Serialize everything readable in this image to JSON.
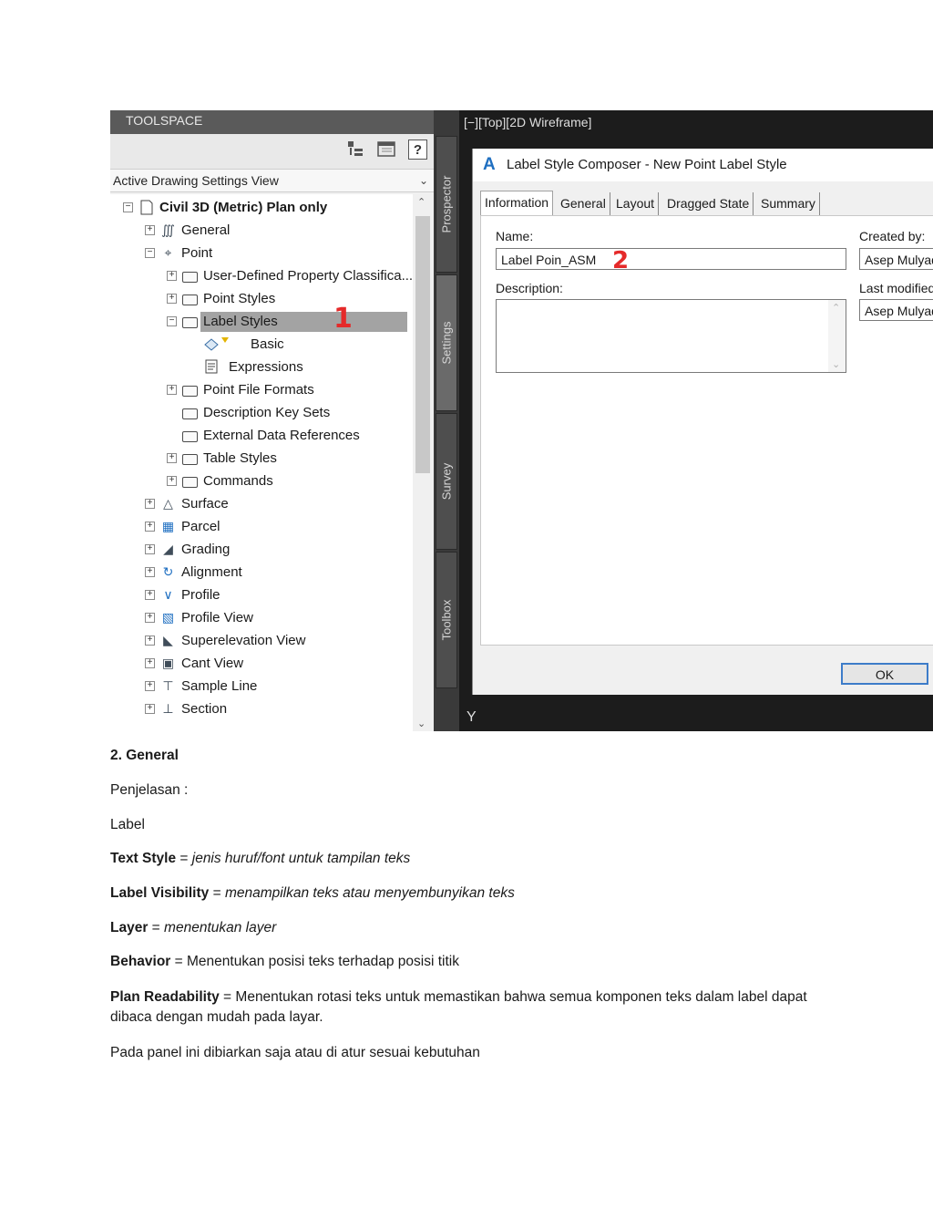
{
  "toolspace": {
    "title": "TOOLSPACE",
    "help_label": "?",
    "view_selector": "Active Drawing Settings View",
    "tree": [
      {
        "label": "Civil 3D (Metric) Plan only",
        "expander": "−",
        "icon": "drawing-icon"
      },
      {
        "label": "General",
        "expander": "+",
        "icon": "general-icon"
      },
      {
        "label": "Point",
        "expander": "−",
        "icon": "point-icon"
      },
      {
        "label": "User-Defined Property Classifica...",
        "expander": "+",
        "icon": "folder-icon"
      },
      {
        "label": "Point Styles",
        "expander": "+",
        "icon": "folder-icon"
      },
      {
        "label": "Label Styles",
        "expander": "−",
        "icon": "folder-icon",
        "selected": true
      },
      {
        "label": "Basic",
        "expander": "",
        "icon": "label-style-icon"
      },
      {
        "label": "Expressions",
        "expander": "",
        "icon": "expressions-icon"
      },
      {
        "label": "Point File Formats",
        "expander": "+",
        "icon": "folder-icon"
      },
      {
        "label": "Description Key Sets",
        "expander": "",
        "icon": "folder-icon"
      },
      {
        "label": "External Data References",
        "expander": "",
        "icon": "folder-icon"
      },
      {
        "label": "Table Styles",
        "expander": "+",
        "icon": "folder-icon"
      },
      {
        "label": "Commands",
        "expander": "+",
        "icon": "folder-icon"
      },
      {
        "label": "Surface",
        "expander": "+",
        "icon": "surface-icon"
      },
      {
        "label": "Parcel",
        "expander": "+",
        "icon": "parcel-icon"
      },
      {
        "label": "Grading",
        "expander": "+",
        "icon": "grading-icon"
      },
      {
        "label": "Alignment",
        "expander": "+",
        "icon": "alignment-icon"
      },
      {
        "label": "Profile",
        "expander": "+",
        "icon": "profile-icon"
      },
      {
        "label": "Profile View",
        "expander": "+",
        "icon": "profile-view-icon"
      },
      {
        "label": "Superelevation View",
        "expander": "+",
        "icon": "superelevation-icon"
      },
      {
        "label": "Cant View",
        "expander": "+",
        "icon": "cant-view-icon"
      },
      {
        "label": "Sample Line",
        "expander": "+",
        "icon": "sample-line-icon"
      },
      {
        "label": "Section",
        "expander": "+",
        "icon": "section-icon"
      }
    ],
    "side_tabs": [
      "Prospector",
      "Settings",
      "Survey",
      "Toolbox"
    ],
    "active_side_tab": "Settings"
  },
  "annotations": {
    "marker1": "1",
    "marker2": "2",
    "color": "#e52a2a"
  },
  "viewport": {
    "label": "[−][Top][2D Wireframe]",
    "ucs_label": "Y"
  },
  "dialog": {
    "title": "Label Style Composer - New Point Label Style",
    "tabs": [
      "Information",
      "General",
      "Layout",
      "Dragged State",
      "Summary"
    ],
    "active_tab": "Information",
    "name_label": "Name:",
    "name_value": "Label Poin_ASM",
    "description_label": "Description:",
    "description_value": "",
    "created_by_label": "Created by:",
    "created_by_value": "Asep Mulyadi",
    "last_modified_label": "Last modified",
    "last_modified_value": "Asep Mulyadi",
    "ok_label": "OK"
  },
  "document": {
    "heading": "2. General",
    "intro": "Penjelasan :",
    "label_word": "Label",
    "items": [
      {
        "term": "Text Style",
        "sep": " = ",
        "desc": "jenis huruf/font untuk tampilan teks",
        "italic": true
      },
      {
        "term": "Label Visibility",
        "sep": " = ",
        "desc": "menampilkan teks atau menyembunyikan teks",
        "italic": true
      },
      {
        "term": "Layer",
        "sep": " = ",
        "desc": "menentukan layer",
        "italic": true
      },
      {
        "term": "Behavior",
        "sep": " = ",
        "desc": "Menentukan posisi teks terhadap posisi titik",
        "italic": false
      },
      {
        "term": "Plan Readability",
        "sep": " = ",
        "desc": "Menentukan rotasi teks untuk memastikan bahwa semua komponen teks dalam label dapat dibaca dengan mudah pada layar.",
        "italic": false
      }
    ],
    "closing": "Pada panel ini dibiarkan saja atau di atur sesuai kebutuhan"
  }
}
